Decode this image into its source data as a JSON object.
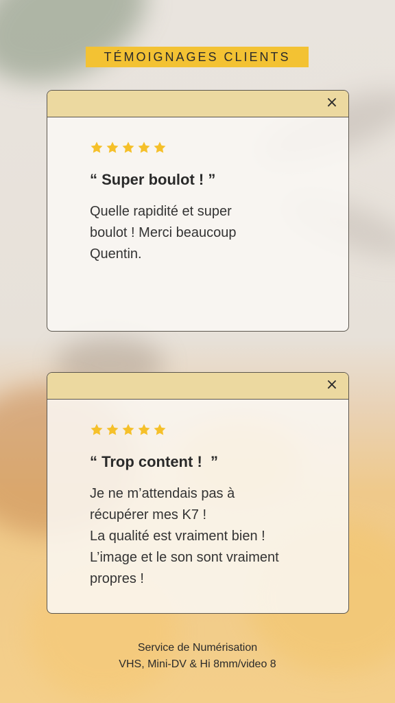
{
  "header": {
    "title": "TÉMOIGNAGES CLIENTS"
  },
  "colors": {
    "accent": "#f3c233",
    "card_bar": "#ecd9a0",
    "star": "#f5c02a"
  },
  "reviews": [
    {
      "close_icon": "×",
      "rating": 5,
      "title": "“ Super boulot ! ”",
      "lines": [
        "Quelle rapidité et super",
        "boulot ! Merci beaucoup",
        "Quentin."
      ]
    },
    {
      "close_icon": "×",
      "rating": 5,
      "title": "“ Trop content !  ”",
      "lines": [
        "Je ne m’attendais pas à",
        "récupérer mes K7 !",
        "La qualité est vraiment bien !",
        "L’image et le son sont vraiment",
        "propres !"
      ]
    }
  ],
  "footer": {
    "line1": "Service de Numérisation",
    "line2": "VHS, Mini-DV & Hi 8mm/video 8"
  }
}
